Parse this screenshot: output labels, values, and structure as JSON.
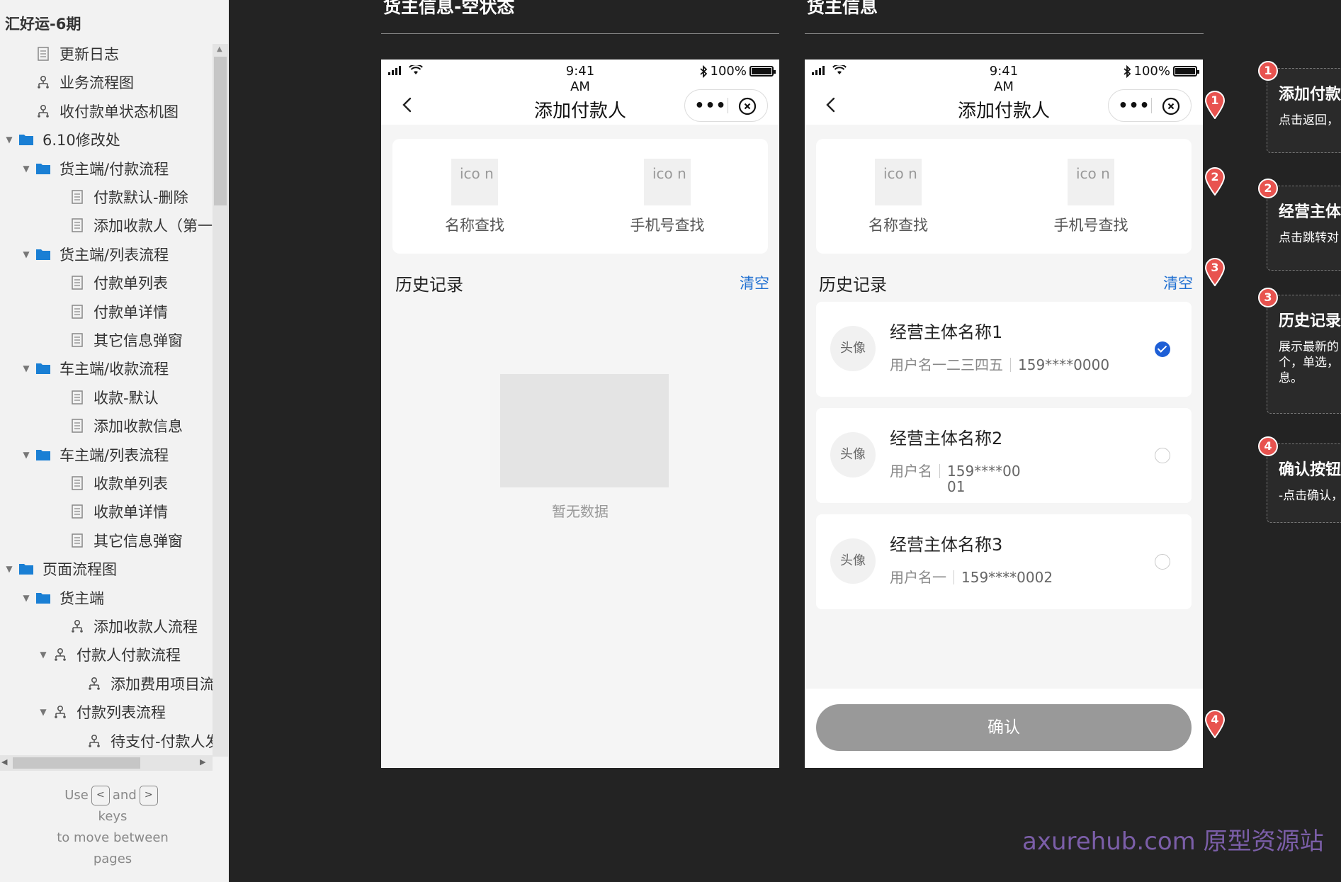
{
  "sidebar": {
    "project_title": "汇好运-6期",
    "items": [
      {
        "label": "更新日志",
        "icon": "page-icon",
        "depth": 1,
        "toggle": ""
      },
      {
        "label": "业务流程图",
        "icon": "flow-icon",
        "depth": 1,
        "toggle": ""
      },
      {
        "label": "收付款单状态机图",
        "icon": "flow-icon",
        "depth": 1,
        "toggle": ""
      },
      {
        "label": "6.10修改处",
        "icon": "folder-icon",
        "depth": 0,
        "toggle": "▼"
      },
      {
        "label": "货主端/付款流程",
        "icon": "folder-icon",
        "depth": 1,
        "toggle": "▼"
      },
      {
        "label": "付款默认-删除",
        "icon": "page-icon",
        "depth": 3,
        "toggle": ""
      },
      {
        "label": "添加收款人（第一步",
        "icon": "page-icon",
        "depth": 3,
        "toggle": ""
      },
      {
        "label": "货主端/列表流程",
        "icon": "folder-icon",
        "depth": 1,
        "toggle": "▼"
      },
      {
        "label": "付款单列表",
        "icon": "page-icon",
        "depth": 3,
        "toggle": ""
      },
      {
        "label": "付款单详情",
        "icon": "page-icon",
        "depth": 3,
        "toggle": ""
      },
      {
        "label": "其它信息弹窗",
        "icon": "page-icon",
        "depth": 3,
        "toggle": ""
      },
      {
        "label": "车主端/收款流程",
        "icon": "folder-icon",
        "depth": 1,
        "toggle": "▼"
      },
      {
        "label": "收款-默认",
        "icon": "page-icon",
        "depth": 3,
        "toggle": ""
      },
      {
        "label": "添加收款信息",
        "icon": "page-icon",
        "depth": 3,
        "toggle": ""
      },
      {
        "label": "车主端/列表流程",
        "icon": "folder-icon",
        "depth": 1,
        "toggle": "▼"
      },
      {
        "label": "收款单列表",
        "icon": "page-icon",
        "depth": 3,
        "toggle": ""
      },
      {
        "label": "收款单详情",
        "icon": "page-icon",
        "depth": 3,
        "toggle": ""
      },
      {
        "label": "其它信息弹窗",
        "icon": "page-icon",
        "depth": 3,
        "toggle": ""
      },
      {
        "label": "页面流程图",
        "icon": "folder-icon",
        "depth": 0,
        "toggle": "▼"
      },
      {
        "label": "货主端",
        "icon": "folder-icon",
        "depth": 1,
        "toggle": "▼"
      },
      {
        "label": "添加收款人流程",
        "icon": "flow-icon",
        "depth": 3,
        "toggle": ""
      },
      {
        "label": "付款人付款流程",
        "icon": "flow-icon",
        "depth": 2,
        "toggle": "▼"
      },
      {
        "label": "添加费用项目流程",
        "icon": "flow-icon",
        "depth": 4,
        "toggle": ""
      },
      {
        "label": "付款列表流程",
        "icon": "flow-icon",
        "depth": 2,
        "toggle": "▼"
      },
      {
        "label": "待支付-付款人发起",
        "icon": "flow-icon",
        "depth": 4,
        "toggle": ""
      }
    ],
    "keys_hint": {
      "use": "Use",
      "prev_key": "<",
      "and": "and",
      "next_key": ">",
      "keys": "keys",
      "line3": "to move between",
      "line4": "pages"
    }
  },
  "sections": [
    {
      "title": "货主信息-空状态"
    },
    {
      "title": "货主信息"
    }
  ],
  "phone": {
    "time": "9:41 AM",
    "battery": "100%",
    "nav_title": "添加付款人",
    "more_label": "•••",
    "search_options": [
      {
        "icon_text": "ico n",
        "label": "名称查找"
      },
      {
        "icon_text": "ico n",
        "label": "手机号查找"
      }
    ],
    "history_title": "历史记录",
    "clear_label": "清空",
    "empty_text": "暂无数据",
    "records": [
      {
        "avatar": "头像",
        "name": "经营主体名称1",
        "user": "用户名一二三四五",
        "phone": "159****0000",
        "selected": true
      },
      {
        "avatar": "头像",
        "name": "经营主体名称2",
        "user": "用户名",
        "phone": "159****0001",
        "selected": false
      },
      {
        "avatar": "头像",
        "name": "经营主体名称3",
        "user": "用户名一",
        "phone": "159****0002",
        "selected": false
      }
    ],
    "confirm_label": "确认"
  },
  "markers": [
    "1",
    "2",
    "3",
    "4"
  ],
  "annotations": [
    {
      "num": "1",
      "title": "添加付款",
      "body": "点击返回，"
    },
    {
      "num": "2",
      "title": "经营主体",
      "body": "点击跳转对"
    },
    {
      "num": "3",
      "title": "历史记录",
      "body": "展示最新的\n个，单选，\n息。"
    },
    {
      "num": "4",
      "title": "确认按钮",
      "body": "-点击确认，"
    }
  ],
  "watermark": "axurehub.com 原型资源站",
  "colors": {
    "accent": "#1f6fd1",
    "marker": "#e8534f",
    "confirm_disabled": "#999999",
    "canvas": "#232323"
  }
}
